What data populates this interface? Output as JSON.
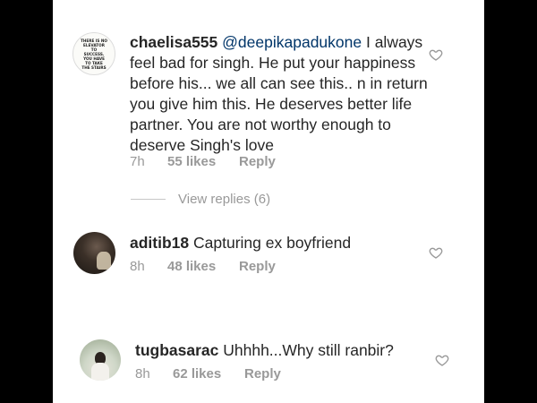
{
  "comments": [
    {
      "username": "chaelisa555",
      "mention": "@deepikapadukone",
      "text": " I always feel bad for singh. He put your happiness before his... we all can see this.. n in return you give him this. He deserves better life partner. You are not worthy enough to deserve Singh's love",
      "time": "7h",
      "likes": "55 likes",
      "reply": "Reply",
      "avatar_text": "THERE IS NO ELEVATOR TO SUCCESS. YOU HAVE TO TAKE THE STAIRS"
    },
    {
      "username": "aditib18",
      "text": " Capturing ex boyfriend",
      "time": "8h",
      "likes": "48 likes",
      "reply": "Reply"
    },
    {
      "username": "tugbasarac",
      "text": " Uhhhh...Why still ranbir?",
      "time": "8h",
      "likes": "62 likes",
      "reply": "Reply"
    }
  ],
  "view_replies": "View replies (6)",
  "colors": {
    "text": "#262626",
    "meta": "#999999",
    "mention": "#003569",
    "frame": "#000000"
  },
  "icons": [
    "heart-outline-icon"
  ]
}
